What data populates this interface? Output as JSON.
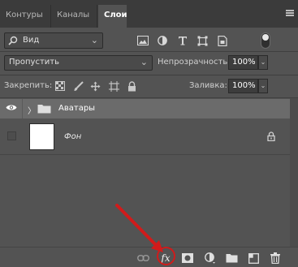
{
  "tabs": [
    {
      "label": "Контуры",
      "active": false
    },
    {
      "label": "Каналы",
      "active": false
    },
    {
      "label": "Слои",
      "active": true
    }
  ],
  "filter": {
    "kind_label": "Вид",
    "icons": [
      "image-filter-icon",
      "adjustment-filter-icon",
      "type-filter-icon",
      "shape-filter-icon",
      "smart-object-filter-icon"
    ]
  },
  "blend": {
    "mode_label": "Пропустить",
    "opacity_label": "Непрозрачность:",
    "opacity_value": "100%"
  },
  "lock": {
    "label": "Закрепить:",
    "fill_label": "Заливка:",
    "fill_value": "100%"
  },
  "layers": [
    {
      "name": "Аватары",
      "type": "group",
      "visible": true,
      "selected": true
    },
    {
      "name": "Фон",
      "type": "background",
      "visible": false,
      "locked": true
    }
  ],
  "bottom_toolbar": {
    "icons": [
      "link-layers-icon",
      "fx-icon",
      "add-mask-icon",
      "new-adjustment-icon",
      "new-group-icon",
      "new-layer-icon",
      "delete-layer-icon"
    ],
    "fx_text": "fx",
    "highlighted": "fx-icon"
  },
  "colors": {
    "panel_bg": "#535353",
    "selected_row": "#6b6b6b",
    "annotation_red": "#d11b1b"
  }
}
